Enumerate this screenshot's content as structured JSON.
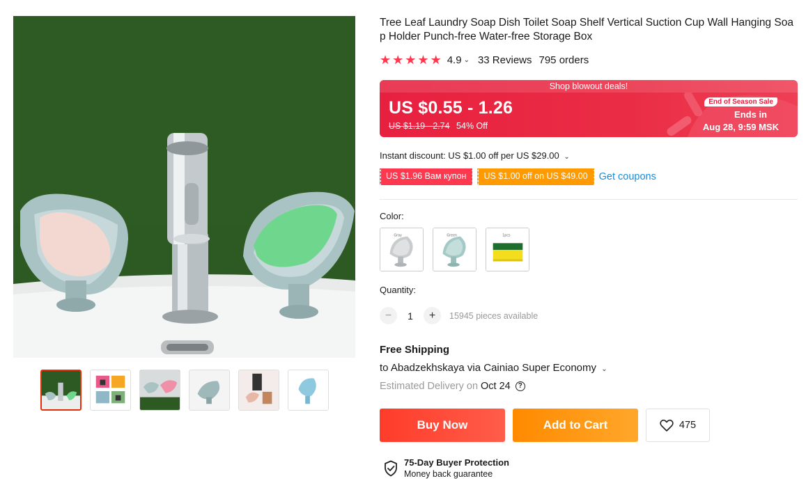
{
  "product": {
    "title": "Tree Leaf Laundry Soap Dish Toilet Soap Shelf Vertical Suction Cup Wall Hanging Soap Holder Punch-free Water-free Storage Box",
    "rating": "4.9",
    "rating_stars": 5,
    "reviews": "33 Reviews",
    "orders": "795 orders"
  },
  "deal": {
    "banner": "Shop blowout deals!",
    "price": "US $0.55 - 1.26",
    "old_price": "US $1.19 - 2.74",
    "discount": "54% Off",
    "sale_badge": "End of Season Sale",
    "ends_in": "Ends in",
    "ends_date": "Aug 28, 9:59 MSK"
  },
  "instant_discount": "Instant discount: US $1.00 off per US $29.00",
  "coupons": {
    "red": "US $1.96 Вам купон",
    "orange": "US $1.00 off on US $49.00",
    "link": "Get coupons"
  },
  "color": {
    "label": "Color:",
    "options": [
      "Gray",
      "Green",
      "1pcs"
    ]
  },
  "quantity": {
    "label": "Quantity:",
    "minus": "−",
    "plus": "+",
    "value": "1",
    "available": "15945 pieces available"
  },
  "shipping": {
    "title": "Free Shipping",
    "to": "to Abadzekhskaya via Cainiao Super Economy",
    "est_label": "Estimated Delivery on",
    "est_date": "Oct 24"
  },
  "actions": {
    "buy": "Buy Now",
    "cart": "Add to Cart",
    "wishlist_count": "475"
  },
  "protection": {
    "title": "75-Day Buyer Protection",
    "subtitle": "Money back guarantee"
  },
  "colors": {
    "accent_red": "#fd384f",
    "deal_red": "#e8203f",
    "coupon_orange": "#ff9a00",
    "link_blue": "#1a8bd8"
  }
}
